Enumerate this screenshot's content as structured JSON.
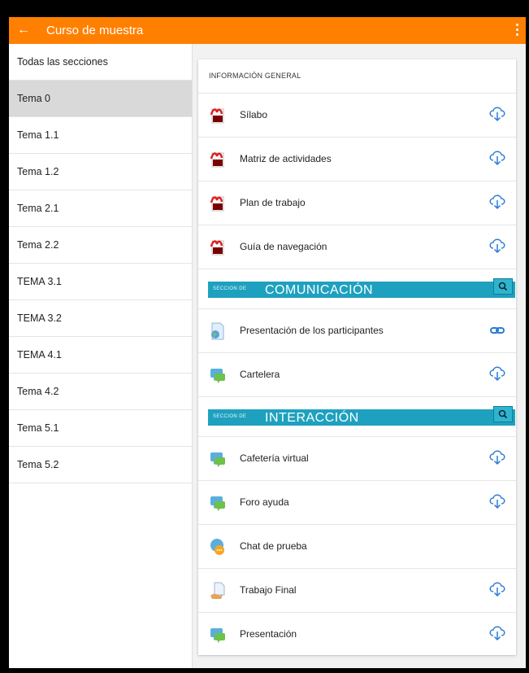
{
  "appbar": {
    "back_icon": "arrow-left-icon",
    "title": "Curso de muestra",
    "menu_icon": "more-vertical-icon"
  },
  "sidebar": {
    "items": [
      {
        "label": "Todas las secciones",
        "active": false
      },
      {
        "label": "Tema 0",
        "active": true
      },
      {
        "label": "Tema 1.1",
        "active": false
      },
      {
        "label": "Tema 1.2",
        "active": false
      },
      {
        "label": "Tema 2.1",
        "active": false
      },
      {
        "label": "Tema 2.2",
        "active": false
      },
      {
        "label": "TEMA 3.1",
        "active": false
      },
      {
        "label": "TEMA 3.2",
        "active": false
      },
      {
        "label": "TEMA 4.1",
        "active": false
      },
      {
        "label": "Tema 4.2",
        "active": false
      },
      {
        "label": "Tema 5.1",
        "active": false
      },
      {
        "label": "Tema 5.2",
        "active": false
      }
    ]
  },
  "section": {
    "header": "INFORMACIÓN GENERAL",
    "rows": [
      {
        "type": "item",
        "label": "Sílabo",
        "icon": "pdf-icon",
        "action": "download-icon"
      },
      {
        "type": "item",
        "label": "Matriz de actividades",
        "icon": "pdf-icon",
        "action": "download-icon"
      },
      {
        "type": "item",
        "label": "Plan de trabajo",
        "icon": "pdf-icon",
        "action": "download-icon"
      },
      {
        "type": "item",
        "label": "Guía de navegación",
        "icon": "pdf-icon",
        "action": "download-icon"
      },
      {
        "type": "banner",
        "small": "SECCIÓN DE",
        "big": "COMUNICACIÓN",
        "action": "search-icon"
      },
      {
        "type": "item",
        "label": "Presentación de los participantes",
        "icon": "web-page-icon",
        "action": "link-icon"
      },
      {
        "type": "item",
        "label": "Cartelera",
        "icon": "forum-icon",
        "action": "download-icon"
      },
      {
        "type": "banner",
        "small": "SECCIÓN DE",
        "big": "INTERACCIÓN",
        "action": "search-icon"
      },
      {
        "type": "item",
        "label": "Cafetería virtual",
        "icon": "forum-icon",
        "action": "download-icon"
      },
      {
        "type": "item",
        "label": "Foro ayuda",
        "icon": "forum-icon",
        "action": "download-icon"
      },
      {
        "type": "item",
        "label": "Chat de prueba",
        "icon": "chat-icon",
        "action": ""
      },
      {
        "type": "item",
        "label": "Trabajo Final",
        "icon": "assignment-icon",
        "action": "download-icon"
      },
      {
        "type": "item",
        "label": "Presentación",
        "icon": "forum-icon",
        "action": "download-icon"
      }
    ]
  },
  "colors": {
    "accent": "#ff8000",
    "banner": "#1ea1bf",
    "active_item": "#d9d9d9",
    "action_icon": "#2a7bd6"
  }
}
